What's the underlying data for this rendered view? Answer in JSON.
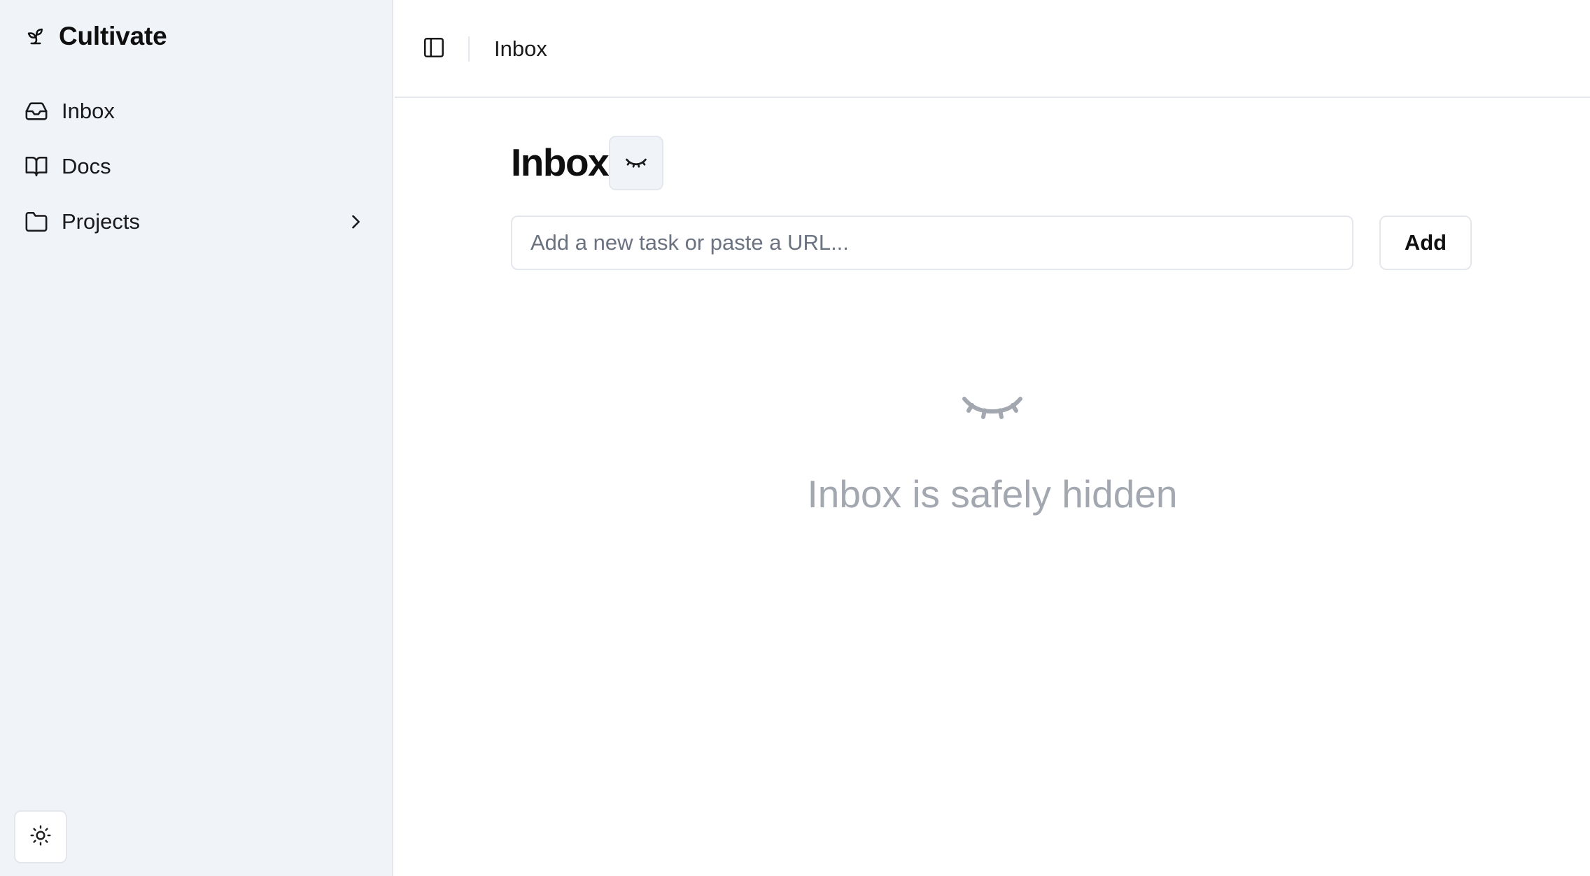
{
  "app": {
    "name": "Cultivate",
    "logo_icon": "sprout-icon"
  },
  "sidebar": {
    "items": [
      {
        "label": "Inbox",
        "icon": "inbox-icon",
        "expandable": false
      },
      {
        "label": "Docs",
        "icon": "book-open-icon",
        "expandable": false
      },
      {
        "label": "Projects",
        "icon": "folder-icon",
        "expandable": true
      }
    ],
    "theme_toggle_icon": "sun-icon"
  },
  "topbar": {
    "sidebar_toggle_icon": "panel-left-icon",
    "breadcrumb": "Inbox"
  },
  "main": {
    "title": "Inbox",
    "hide_toggle_icon": "eye-closed-icon",
    "input": {
      "placeholder": "Add a new task or paste a URL...",
      "value": ""
    },
    "add_button_label": "Add",
    "empty_state": {
      "icon": "eye-closed-icon",
      "message": "Inbox is safely hidden"
    }
  },
  "colors": {
    "sidebar_bg": "#f0f4f9",
    "border": "#e4e7ec",
    "muted_text": "#a3a7b0",
    "placeholder_text": "#6b7280",
    "primary_text": "#0f0f10"
  }
}
